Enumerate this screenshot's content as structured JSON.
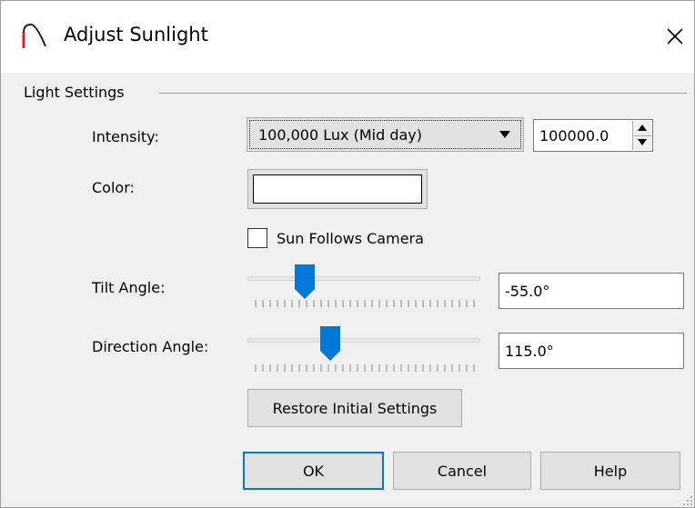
{
  "window": {
    "title": "Adjust Sunlight",
    "icon": "arc-icon",
    "close_icon": "close-icon"
  },
  "group": {
    "label": "Light Settings"
  },
  "intensity": {
    "label": "Intensity:",
    "selected": "100,000 Lux (Mid day)",
    "value": "100000.0"
  },
  "color": {
    "label": "Color:",
    "swatch": "#ffffff"
  },
  "sun_follows": {
    "label": "Sun Follows Camera",
    "checked": false
  },
  "tilt": {
    "label": "Tilt Angle:",
    "value": "-55.0°",
    "slider_fraction": 0.22
  },
  "direction": {
    "label": "Direction Angle:",
    "value": "115.0°",
    "slider_fraction": 0.34
  },
  "buttons": {
    "restore": "Restore Initial Settings",
    "ok": "OK",
    "cancel": "Cancel",
    "help": "Help"
  },
  "colors": {
    "accent": "#0078d7",
    "thumb": "#0078d7",
    "icon_red": "#d9232b"
  }
}
